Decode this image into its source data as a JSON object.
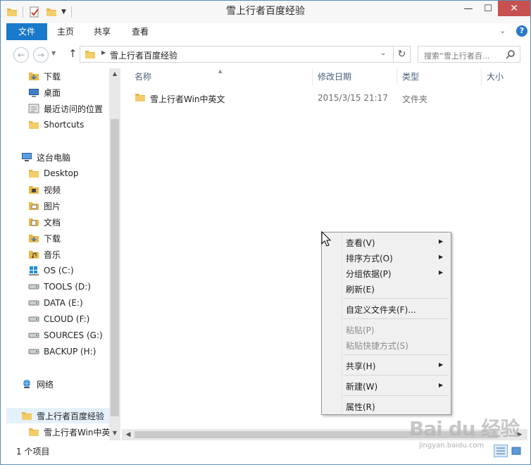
{
  "window": {
    "title": "雪上行者百度经验",
    "min_glyph": "—",
    "max_glyph": "☐",
    "close_glyph": "✕"
  },
  "ribbon": {
    "tabs": [
      "文件",
      "主页",
      "共享",
      "查看"
    ],
    "expand_glyph": "⌄",
    "help_glyph": "?"
  },
  "address": {
    "path": "雪上行者百度经验",
    "search_placeholder": "搜索“雪上行者百...",
    "back_glyph": "←",
    "forward_glyph": "→",
    "up_glyph": "↑"
  },
  "nav_pane": {
    "items": [
      {
        "label": "下载",
        "icon": "downloads-icon"
      },
      {
        "label": "桌面",
        "icon": "desktop-icon"
      },
      {
        "label": "最近访问的位置",
        "icon": "recent-places-icon"
      },
      {
        "label": "Shortcuts",
        "icon": "folder-icon"
      },
      {
        "label": "这台电脑",
        "icon": "computer-icon"
      },
      {
        "label": "Desktop",
        "icon": "folder-icon"
      },
      {
        "label": "视频",
        "icon": "videos-icon"
      },
      {
        "label": "图片",
        "icon": "pictures-icon"
      },
      {
        "label": "文档",
        "icon": "documents-icon"
      },
      {
        "label": "下载",
        "icon": "downloads-icon"
      },
      {
        "label": "音乐",
        "icon": "music-icon"
      },
      {
        "label": "OS (C:)",
        "icon": "windows-drive-icon"
      },
      {
        "label": "TOOLS (D:)",
        "icon": "drive-icon"
      },
      {
        "label": "DATA (E:)",
        "icon": "drive-icon"
      },
      {
        "label": "CLOUD (F:)",
        "icon": "drive-icon"
      },
      {
        "label": "SOURCES (G:)",
        "icon": "drive-icon"
      },
      {
        "label": "BACKUP (H:)",
        "icon": "drive-icon"
      },
      {
        "label": "网络",
        "icon": "network-icon"
      },
      {
        "label": "雪上行者百度经验",
        "icon": "folder-icon"
      },
      {
        "label": "雪上行者Win中英",
        "icon": "folder-icon"
      }
    ]
  },
  "columns": [
    "名称",
    "修改日期",
    "类型",
    "大小"
  ],
  "files": [
    {
      "name": "雪上行者Win中英文",
      "date": "2015/3/15 21:17",
      "type": "文件夹",
      "size": ""
    }
  ],
  "status": {
    "item_count": "1 个项目"
  },
  "context_menu": {
    "items": [
      {
        "label": "查看(V)",
        "submenu": true,
        "disabled": false
      },
      {
        "label": "排序方式(O)",
        "submenu": true,
        "disabled": false
      },
      {
        "label": "分组依据(P)",
        "submenu": true,
        "disabled": false
      },
      {
        "label": "刷新(E)",
        "submenu": false,
        "disabled": false
      },
      {
        "label": "自定义文件夹(F)...",
        "submenu": false,
        "disabled": false
      },
      {
        "label": "粘贴(P)",
        "submenu": false,
        "disabled": true
      },
      {
        "label": "粘贴快捷方式(S)",
        "submenu": false,
        "disabled": true
      },
      {
        "label": "共享(H)",
        "submenu": true,
        "disabled": false
      },
      {
        "label": "新建(W)",
        "submenu": true,
        "disabled": false
      },
      {
        "label": "属性(R)",
        "submenu": false,
        "disabled": false
      }
    ],
    "submenu_glyph": "▶"
  },
  "watermark": {
    "text": "Bai du 经验",
    "url": "jingyan.baidu.com"
  },
  "colors": {
    "file_tab": "#1979ca",
    "close_button": "#c75050",
    "folder": "#e8b84a",
    "selection": "#e5f1fb"
  }
}
